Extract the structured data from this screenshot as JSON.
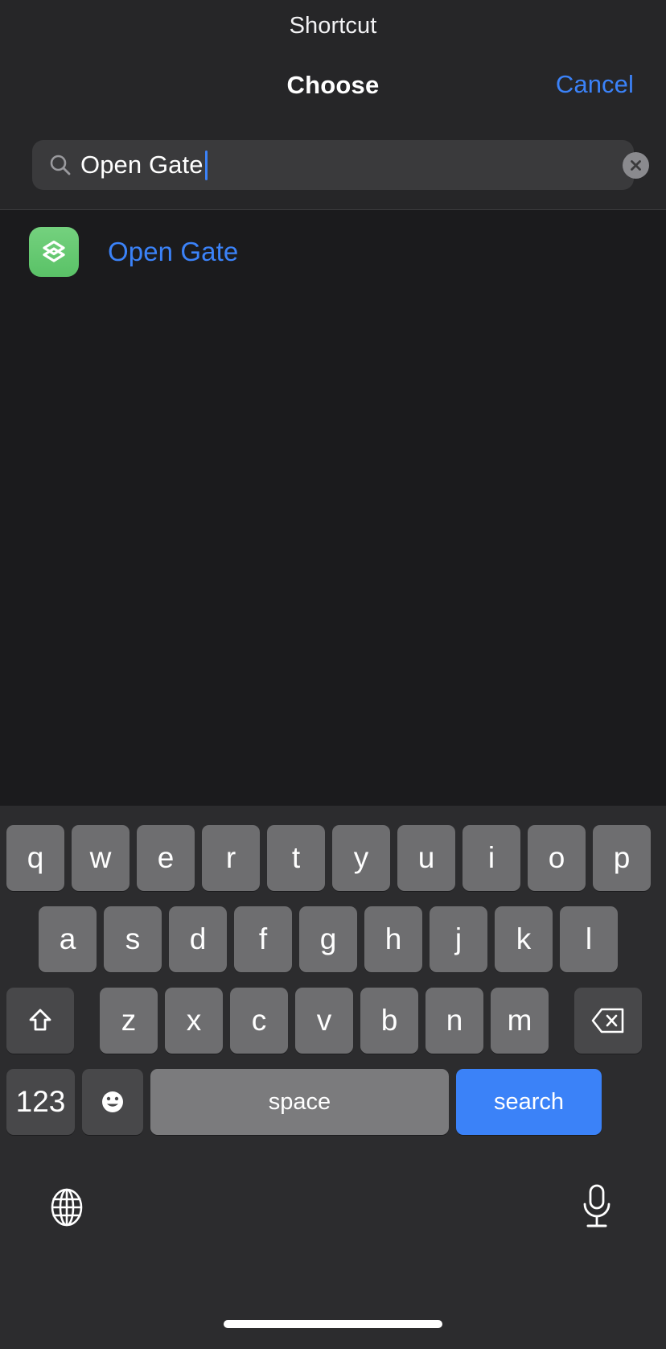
{
  "sheet": {
    "app_title": "Shortcut",
    "nav_title": "Choose",
    "cancel_label": "Cancel"
  },
  "search": {
    "icon": "search-icon",
    "value": "Open Gate",
    "placeholder": "Search",
    "clear_icon": "clear-circle-icon",
    "caret_color": "#3b82f8"
  },
  "results": [
    {
      "label": "Open Gate",
      "icon": "layers-stack-icon",
      "icon_color": "#5ac267",
      "label_color": "#3b82f8"
    }
  ],
  "keyboard": {
    "row1": [
      "q",
      "w",
      "e",
      "r",
      "t",
      "y",
      "u",
      "i",
      "o",
      "p"
    ],
    "row2": [
      "a",
      "s",
      "d",
      "f",
      "g",
      "h",
      "j",
      "k",
      "l"
    ],
    "row3": [
      "z",
      "x",
      "c",
      "v",
      "b",
      "n",
      "m"
    ],
    "shift_icon": "shift-arrow-icon",
    "delete_icon": "backspace-icon",
    "numbers_label": "123",
    "emoji_icon": "emoji-smiley-icon",
    "space_label": "space",
    "return_label": "search",
    "globe_icon": "globe-icon",
    "mic_icon": "microphone-icon",
    "return_key_color": "#3b82f8"
  }
}
